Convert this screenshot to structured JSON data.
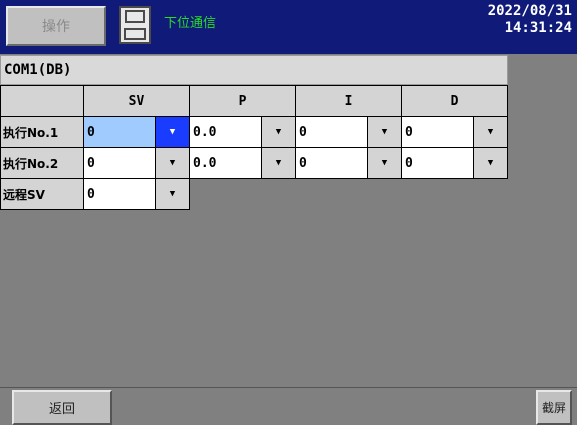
{
  "header": {
    "operate_button": "操作",
    "save_icon": "floppy-save-icon",
    "comm_label": "下位通信",
    "date": "2022/08/31",
    "time": "14:31:24"
  },
  "title": "COM1(DB)",
  "table": {
    "columns": [
      "SV",
      "P",
      "I",
      "D"
    ],
    "rows": [
      {
        "label": "执行No.1",
        "values": [
          "0",
          "0.0",
          "0",
          "0"
        ]
      },
      {
        "label": "执行No.2",
        "values": [
          "0",
          "0.0",
          "0",
          "0"
        ]
      },
      {
        "label": "远程SV",
        "values": [
          "0"
        ]
      }
    ],
    "dropdown_icon": "triangle-down-icon"
  },
  "footer": {
    "back_button": "返回",
    "screenshot_button": "截屏"
  },
  "colors": {
    "topbar": "#101a78",
    "comm_label": "#28dd28",
    "selected_value": "#9fcbff",
    "selected_dropdown": "#1a3cff",
    "background": "#808080"
  }
}
